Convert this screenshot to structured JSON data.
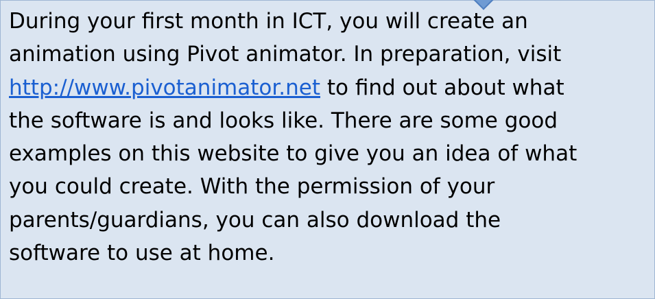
{
  "callout": {
    "line1": "During your first month in ICT, you will create an",
    "line2": "animation using Pivot animator. In preparation, visit",
    "link_text": "http://www.pivotanimator.net",
    "after_link": " to find out about what",
    "line4": "the software is and looks like. There are some good",
    "line5": "examples on this website to give you an idea of what",
    "line6": "you could create. With the permission of your",
    "line7": "parents/guardians, you can also download the",
    "line8": "software to use at home."
  }
}
